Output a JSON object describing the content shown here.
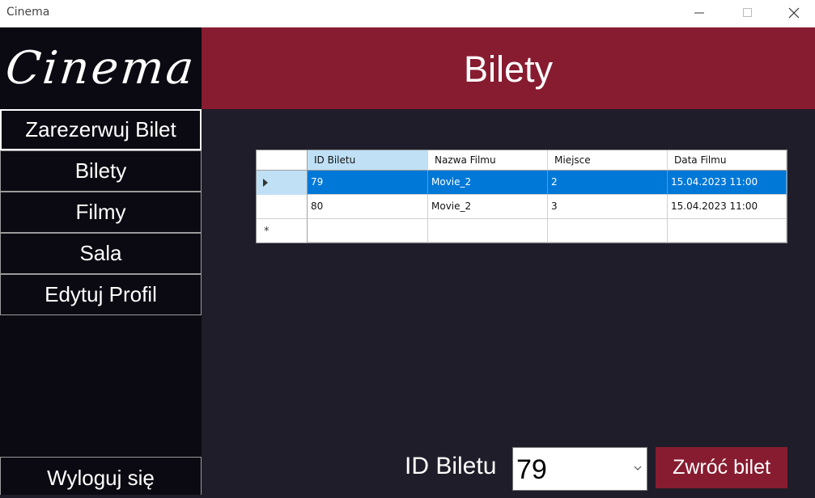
{
  "window": {
    "title": "Cinema",
    "controls": [
      "minimize-icon",
      "maximize-icon",
      "close-icon"
    ]
  },
  "sidebar": {
    "logo": "Cinema",
    "items": [
      {
        "label": "Zarezerwuj Bilet",
        "active": true
      },
      {
        "label": "Bilety",
        "active": false
      },
      {
        "label": "Filmy",
        "active": false
      },
      {
        "label": "Sala",
        "active": false
      },
      {
        "label": "Edytuj Profil",
        "active": false
      }
    ],
    "logout_label": "Wyloguj się"
  },
  "header": {
    "title": "Bilety"
  },
  "grid": {
    "columns": [
      "ID Biletu",
      "Nazwa Filmu",
      "Miejsce",
      "Data Filmu"
    ],
    "rows": [
      [
        "79",
        "Movie_2",
        "2",
        "15.04.2023 11:00"
      ],
      [
        "80",
        "Movie_2",
        "3",
        "15.04.2023 11:00"
      ]
    ],
    "selected_row": 0,
    "new_row_marker": "*"
  },
  "form": {
    "id_label": "ID Biletu",
    "selected_id": "79",
    "return_label": "Zwróć bilet"
  },
  "colors": {
    "accent": "#871c30",
    "sidebar_bg": "#0b0a12",
    "content_bg": "#1f1d29",
    "selection": "#0078d7"
  }
}
